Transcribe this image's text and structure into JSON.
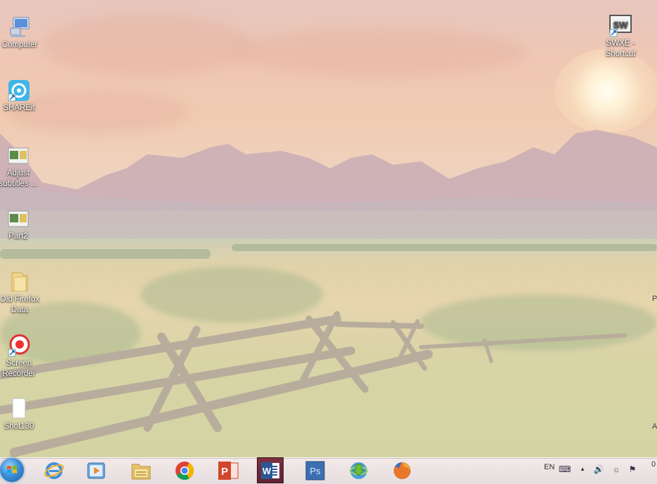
{
  "desktop": {
    "icons": [
      {
        "label": "Computer",
        "icon": "computer-icon"
      },
      {
        "label": "SHAREit",
        "icon": "shareit-icon"
      },
      {
        "label_line1": "Adjust",
        "label_line2": "subtitles ...",
        "icon": "video-file-icon"
      },
      {
        "label": "Part2",
        "icon": "video-file-icon"
      },
      {
        "label_line1": "Old Firefox",
        "label_line2": "Data",
        "icon": "folder-icon"
      },
      {
        "label_line1": "Screen",
        "label_line2": "Recorder",
        "icon": "screen-recorder-icon"
      },
      {
        "label": "Shot130",
        "icon": "document-icon"
      },
      {
        "label_line1": "SWXE -",
        "label_line2": "Shortcut",
        "icon": "swxe-shortcut-icon",
        "glyph_text": "SW"
      }
    ],
    "edge_letters": [
      "P",
      "A"
    ]
  },
  "taskbar": {
    "pinned": [
      {
        "name": "internet-explorer"
      },
      {
        "name": "windows-media-player"
      },
      {
        "name": "windows-explorer"
      },
      {
        "name": "google-chrome"
      },
      {
        "name": "powerpoint",
        "glyph": "P"
      },
      {
        "name": "word",
        "glyph": "W",
        "active": true
      },
      {
        "name": "photoshop",
        "glyph": "Ps"
      },
      {
        "name": "internet-download-manager"
      },
      {
        "name": "firefox"
      }
    ],
    "tray": {
      "language": "EN",
      "clock_fragment": "0"
    }
  },
  "colors": {
    "word_active": "#7a2433",
    "word_blue": "#2b5797",
    "powerpoint": "#d0462b",
    "photoshop": "#3b6fb0",
    "start_blue": "#3a8fd6"
  }
}
